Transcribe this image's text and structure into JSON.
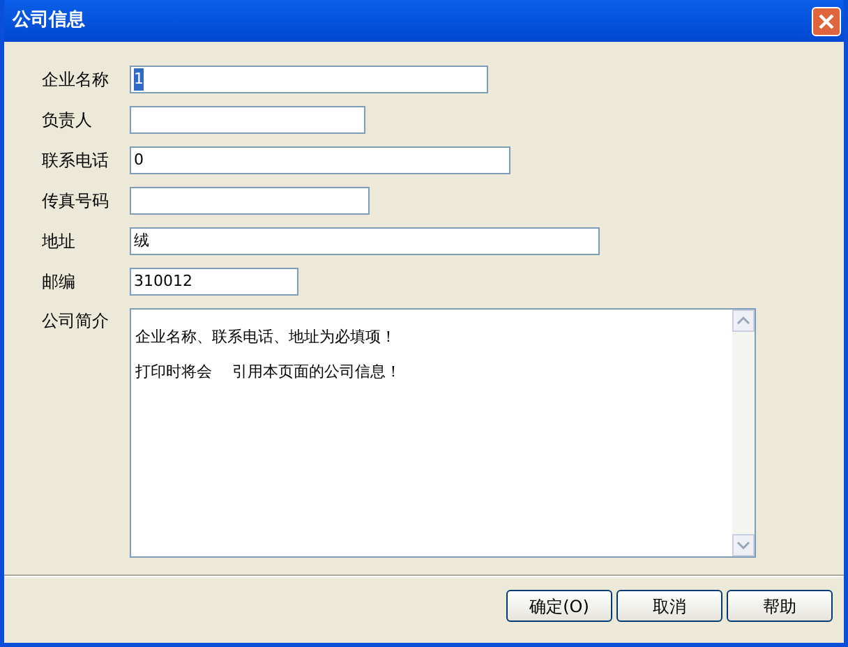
{
  "window": {
    "title": "公司信息"
  },
  "fields": [
    {
      "label": "企业名称",
      "value": "1",
      "text_selected": true
    },
    {
      "label": "负责人"
    },
    {
      "label": "联系电话",
      "value": "0",
      "text_selected": false
    },
    {
      "label": "传真号码"
    },
    {
      "label": "地址",
      "value": "绒",
      "text_selected": false
    },
    {
      "label": "邮编",
      "value": "310012",
      "text_selected": false
    }
  ],
  "description": {
    "label": "公司简介",
    "lines": [
      "企业名称、联系电话、地址为必填项！",
      "打印时将会　 引用本页面的公司信息！"
    ]
  },
  "buttons": [
    "确定(O)",
    "取消",
    "帮助"
  ]
}
